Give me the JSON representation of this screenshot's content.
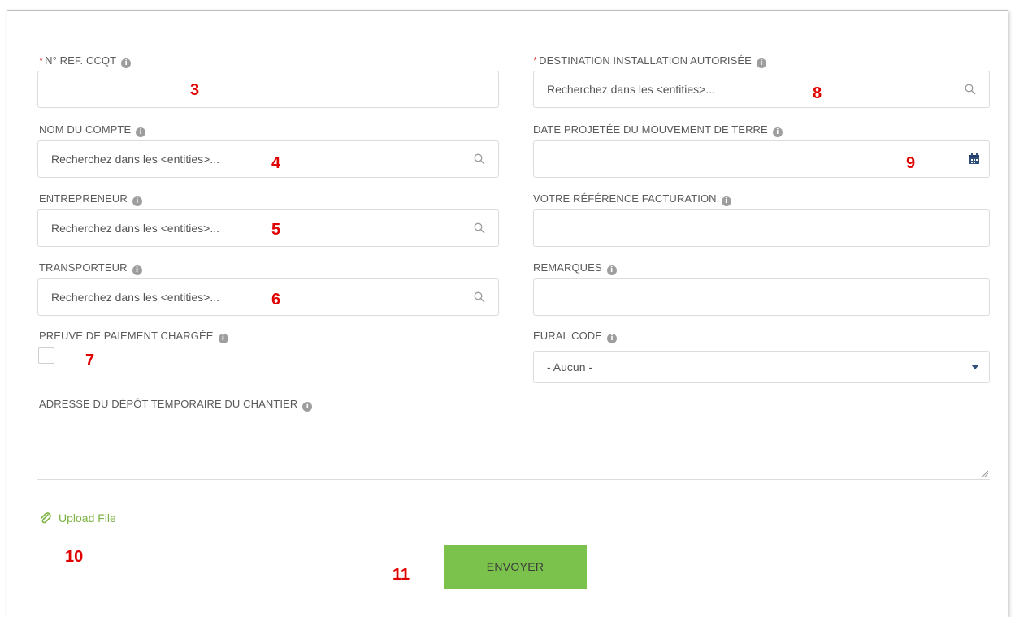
{
  "form": {
    "ref_ccqt": {
      "label": "N° REF. CCQT",
      "required": true,
      "value": ""
    },
    "destination": {
      "label": "DESTINATION INSTALLATION AUTORISÉE",
      "required": true,
      "placeholder": "Recherchez dans les <entities>..."
    },
    "nom_compte": {
      "label": "NOM DU COMPTE",
      "placeholder": "Recherchez dans les <entities>..."
    },
    "date_projetee": {
      "label": "DATE PROJETÉE DU MOUVEMENT DE TERRE",
      "value": ""
    },
    "entrepreneur": {
      "label": "ENTREPRENEUR",
      "placeholder": "Recherchez dans les <entities>..."
    },
    "reference_facturation": {
      "label": "VOTRE RÉFÉRENCE FACTURATION",
      "value": ""
    },
    "transporteur": {
      "label": "TRANSPORTEUR",
      "placeholder": "Recherchez dans les <entities>..."
    },
    "remarques": {
      "label": "REMARQUES",
      "value": ""
    },
    "preuve_paiement": {
      "label": "PREUVE DE PAIEMENT CHARGÉE",
      "checked": false
    },
    "eural_code": {
      "label": "EURAL CODE",
      "selected": "- Aucun -"
    },
    "adresse_depot": {
      "label": "ADRESSE DU DÉPÔT TEMPORAIRE DU CHANTIER",
      "value": ""
    },
    "upload_label": "Upload File",
    "submit_label": "ENVOYER",
    "required_marker": "*",
    "info_glyph": "i"
  },
  "annotations": [
    "3",
    "4",
    "5",
    "6",
    "7",
    "8",
    "9",
    "10",
    "11"
  ],
  "colors": {
    "accent_green": "#7bc24c",
    "upload_green": "#7cb342",
    "annotation_red": "#e00000",
    "required_red": "#d9534f"
  },
  "icons": {
    "search": "search-icon",
    "calendar": "calendar-icon",
    "info": "info-icon",
    "paperclip": "paperclip-icon",
    "caret": "caret-down-icon"
  }
}
